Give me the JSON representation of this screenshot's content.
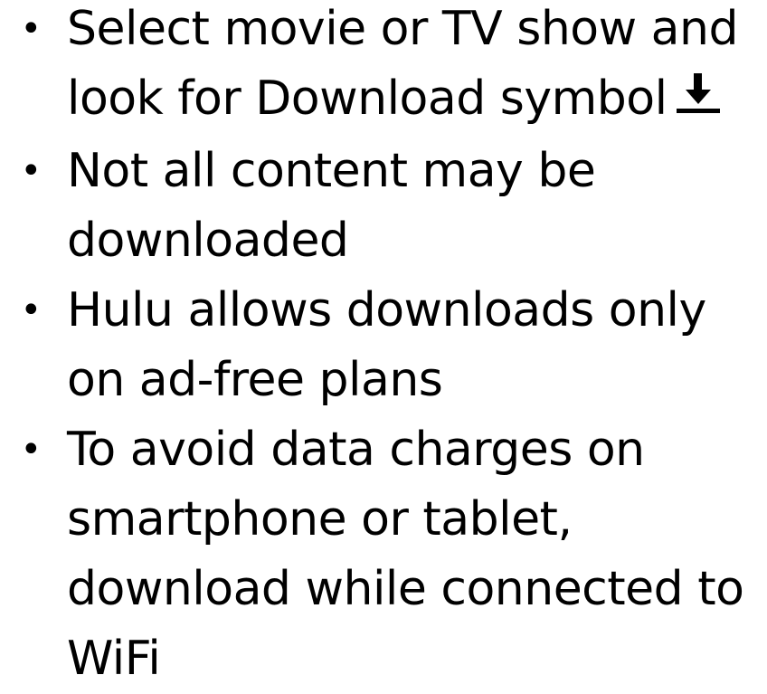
{
  "bullets": [
    {
      "text": "Select movie or TV show and look for Download symbol",
      "icon": "download-arrow-icon"
    },
    {
      "text": "Not all content may be downloaded"
    },
    {
      "text": "Hulu allows downloads only on ad-free plans"
    },
    {
      "text": "To avoid data charges on smartphone or tablet, download while connected to WiFi"
    }
  ],
  "bullet_glyph": "•",
  "colors": {
    "text": "#000000",
    "background": "#ffffff"
  }
}
